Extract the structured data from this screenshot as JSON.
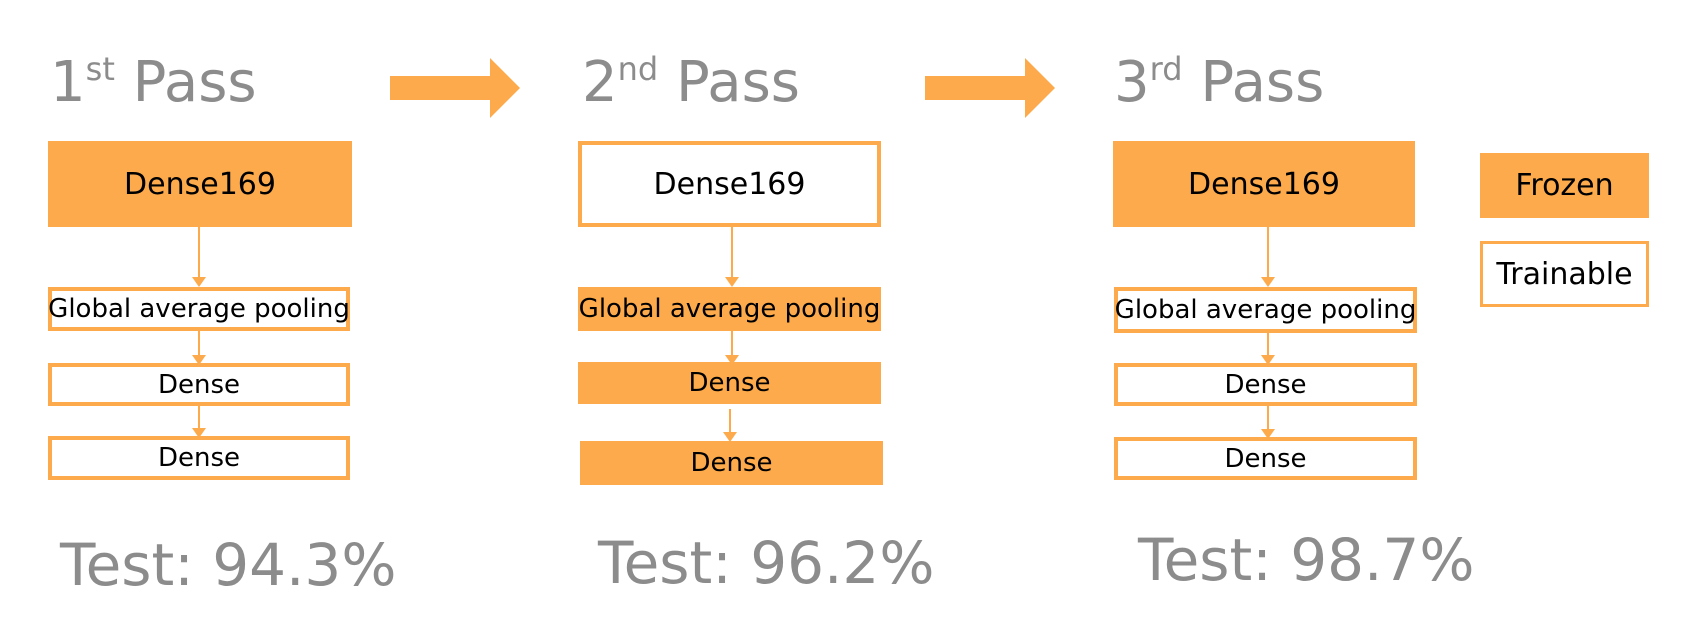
{
  "colors": {
    "accent": "#fcaa4b",
    "title_gray": "#8c8c8c",
    "text": "#000000",
    "background": "#ffffff"
  },
  "passes": [
    {
      "ordinal": "1",
      "suffix": "st",
      "word": "Pass",
      "backbone": {
        "label": "Dense169",
        "state": "frozen"
      },
      "layers": [
        {
          "label": "Global average pooling",
          "state": "trainable"
        },
        {
          "label": "Dense",
          "state": "trainable"
        },
        {
          "label": "Dense",
          "state": "trainable"
        }
      ],
      "test": "Test: 94.3%"
    },
    {
      "ordinal": "2",
      "suffix": "nd",
      "word": "Pass",
      "backbone": {
        "label": "Dense169",
        "state": "trainable"
      },
      "layers": [
        {
          "label": "Global average pooling",
          "state": "frozen"
        },
        {
          "label": "Dense",
          "state": "frozen"
        },
        {
          "label": "Dense",
          "state": "frozen"
        }
      ],
      "test": "Test: 96.2%"
    },
    {
      "ordinal": "3",
      "suffix": "rd",
      "word": "Pass",
      "backbone": {
        "label": "Dense169",
        "state": "frozen"
      },
      "layers": [
        {
          "label": "Global average pooling",
          "state": "trainable"
        },
        {
          "label": "Dense",
          "state": "trainable"
        },
        {
          "label": "Dense",
          "state": "trainable"
        }
      ],
      "test": "Test: 98.7%"
    }
  ],
  "legend": {
    "frozen": "Frozen",
    "trainable": "Trainable"
  },
  "icons": {
    "flow_arrow": "right-arrow-icon",
    "connector": "down-arrow-icon"
  }
}
